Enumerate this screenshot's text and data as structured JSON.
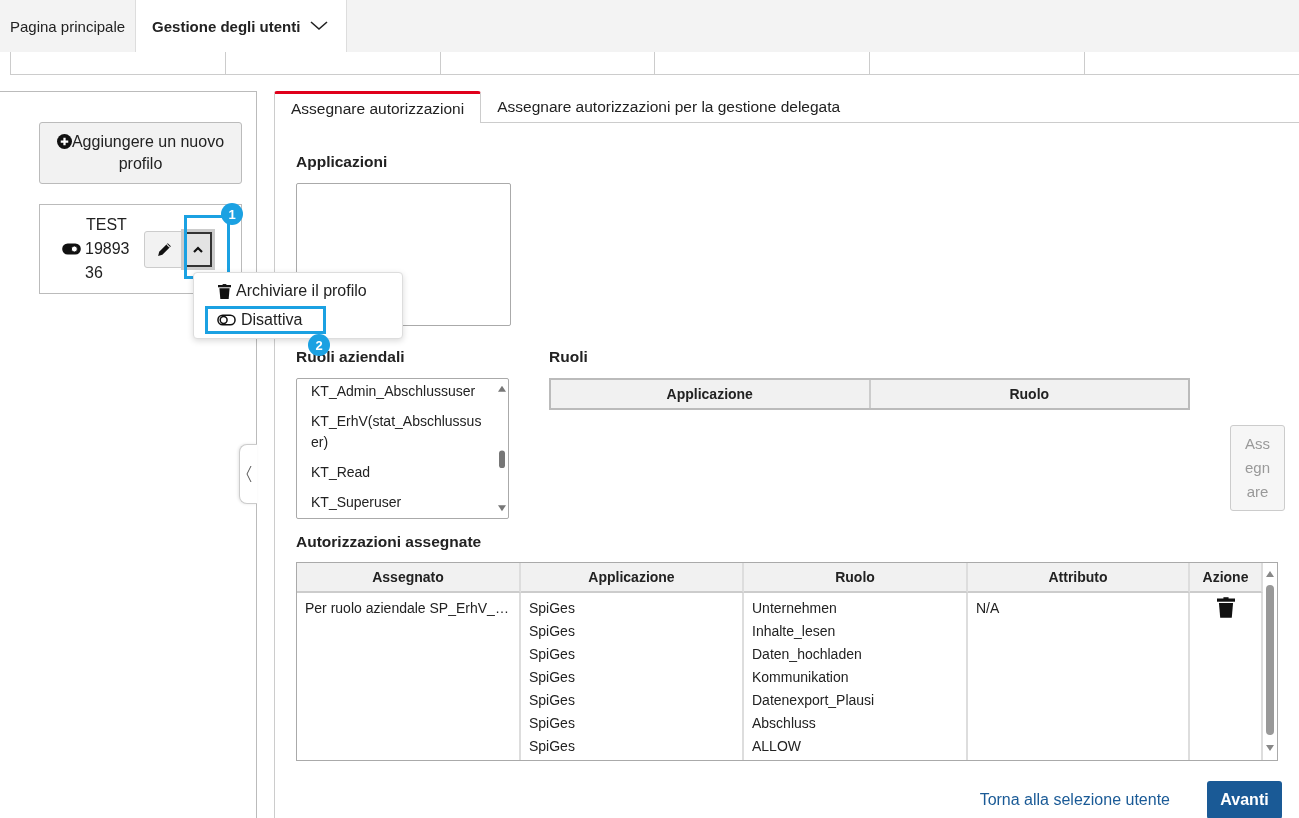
{
  "nav_tabs": [
    {
      "label": "Pagina principale",
      "selected": false,
      "dropdown": false
    },
    {
      "label": "Gestione degli utenti",
      "selected": true,
      "dropdown": true
    }
  ],
  "sidebar": {
    "add_button": "Aggiungere un nuovo profilo",
    "profile": {
      "name": "TEST",
      "number": "1989336",
      "active": true,
      "menu_open": true
    },
    "menu": [
      {
        "kind": "trash",
        "label": "Archiviare il profilo"
      },
      {
        "kind": "toggle",
        "label": "Disattiva"
      }
    ]
  },
  "callouts": [
    {
      "number": "1"
    },
    {
      "number": "2"
    }
  ],
  "main_tabs": [
    {
      "label": "Assegnare autorizzazioni",
      "selected": true
    },
    {
      "label": "Assegnare autorizzazioni per la gestione delegata",
      "selected": false
    }
  ],
  "applications": {
    "label": "Applicazioni"
  },
  "business_roles": {
    "label": "Ruoli aziendali",
    "items": [
      "KT_Admin_Abschlussuser",
      "KT_ErhV(stat_Abschlussuser)",
      "KT_Read",
      "KT_Superuser"
    ]
  },
  "roles": {
    "label": "Ruoli",
    "columns": [
      "Applicazione",
      "Ruolo"
    ]
  },
  "assign_button": {
    "label": "Assegnare",
    "disabled": true
  },
  "assigned": {
    "label": "Autorizzazioni assegnate",
    "columns": [
      "Assegnato",
      "Applicazione",
      "Ruolo",
      "Attributo",
      "Azione"
    ],
    "rows": [
      {
        "assigned": "Per ruolo aziendale SP_ErhV_…",
        "applications": [
          "SpiGes",
          "SpiGes",
          "SpiGes",
          "SpiGes",
          "SpiGes",
          "SpiGes",
          "SpiGes"
        ],
        "roles": [
          "Unternehmen",
          "Inhalte_lesen",
          "Daten_hochladen",
          "Kommunikation",
          "Datenexport_Plausi",
          "Abschluss",
          "ALLOW"
        ],
        "attribute": "N/A"
      }
    ]
  },
  "footer": {
    "back_link": "Torna alla selezione utente",
    "next_button": "Avanti"
  }
}
